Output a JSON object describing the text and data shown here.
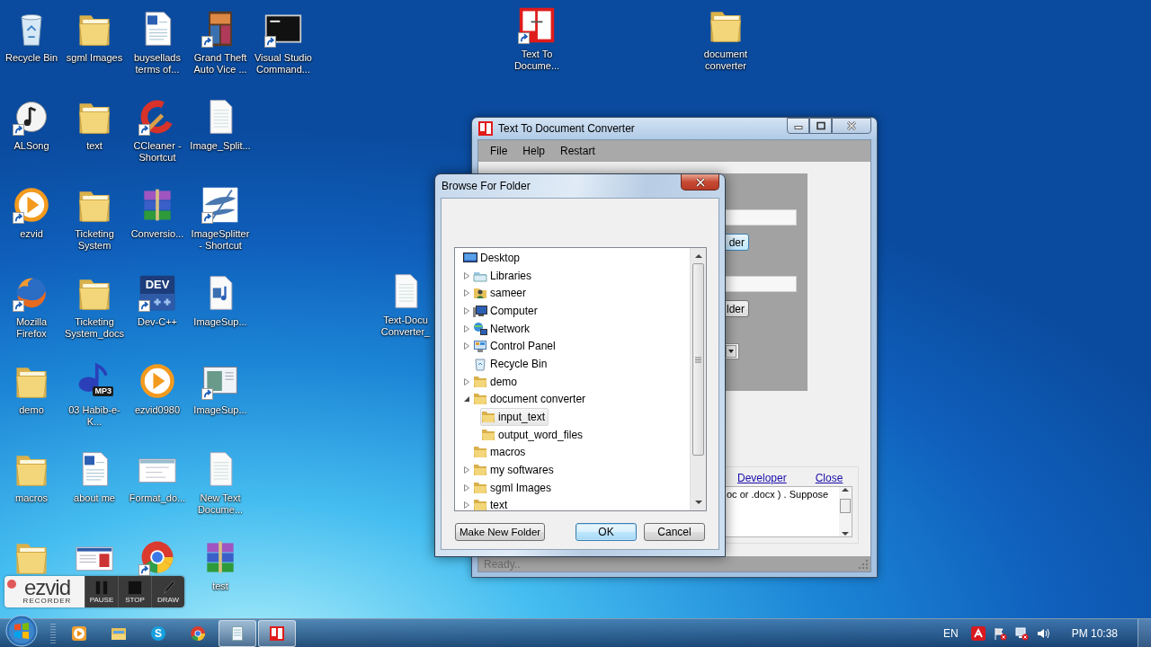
{
  "desktop": {
    "columns": [
      [
        {
          "label": "Recycle Bin",
          "kind": "recycle",
          "shortcut": false
        },
        {
          "label": "ALSong",
          "kind": "music-app",
          "shortcut": true
        },
        {
          "label": "ezvid",
          "kind": "player",
          "shortcut": true
        },
        {
          "label": "Mozilla Firefox",
          "kind": "firefox",
          "shortcut": true
        },
        {
          "label": "demo",
          "kind": "folder",
          "shortcut": false
        },
        {
          "label": "macros",
          "kind": "folder",
          "shortcut": false
        },
        {
          "kind": "folder",
          "shortcut": false
        }
      ],
      [
        {
          "label": "sgml Images",
          "kind": "folder",
          "shortcut": false
        },
        {
          "label": "text",
          "kind": "folder",
          "shortcut": false
        },
        {
          "label": "Ticketing System",
          "kind": "folder",
          "shortcut": false
        },
        {
          "label": "Ticketing System_docs",
          "kind": "folder",
          "shortcut": false
        },
        {
          "label": "03 Habib-e-K...",
          "kind": "mp3",
          "badge": "MP3",
          "shortcut": false
        },
        {
          "label": "about me",
          "kind": "word-doc",
          "shortcut": false
        },
        {
          "kind": "screenshot",
          "shortcut": false
        }
      ],
      [
        {
          "label": "buysellads terms of...",
          "kind": "word-doc",
          "shortcut": false
        },
        {
          "label": "CCleaner - Shortcut",
          "kind": "ccleaner",
          "shortcut": true
        },
        {
          "label": "Conversio...",
          "kind": "archive",
          "shortcut": false
        },
        {
          "label": "Dev-C++",
          "kind": "dev",
          "badge": "DEV",
          "shortcut": true
        },
        {
          "label": "ezvid0980",
          "kind": "player",
          "shortcut": false
        },
        {
          "label": "Format_do...",
          "kind": "page-thumb",
          "shortcut": false
        },
        {
          "kind": "chrome",
          "shortcut": true
        }
      ],
      [
        {
          "label": "Grand Theft Auto Vice ...",
          "kind": "game",
          "shortcut": true
        },
        {
          "label": "Image_Split...",
          "kind": "text-file",
          "shortcut": false
        },
        {
          "label": "ImageSplitter - Shortcut",
          "kind": "splitter",
          "shortcut": true
        },
        {
          "label": "ImageSup...",
          "kind": "media-file",
          "shortcut": false
        },
        {
          "label": "ImageSup...",
          "kind": "window-thumb",
          "shortcut": true
        },
        {
          "label": "New Text Docume...",
          "kind": "text-file",
          "shortcut": false
        },
        {
          "label": "test",
          "kind": "archive",
          "shortcut": false
        }
      ],
      [
        {
          "label": "Visual Studio Command...",
          "kind": "console",
          "shortcut": true
        }
      ]
    ],
    "loose_icons": [
      {
        "label": "Text To Docume...",
        "kind": "converter-app",
        "shortcut": true
      },
      {
        "label": "document converter",
        "kind": "folder",
        "shortcut": false
      },
      {
        "label": "Text-Docu Converter_",
        "kind": "text-file",
        "shortcut": false
      }
    ]
  },
  "converter_window": {
    "title": "Text To Document Converter",
    "menu": [
      "File",
      "Help",
      "Restart"
    ],
    "panel_buttons": [
      "der",
      "lder"
    ],
    "links": [
      "Developer",
      "Close"
    ],
    "notes": "oc or .docx ) . Suppose",
    "status": "Ready.."
  },
  "dialog": {
    "title": "Browse For Folder",
    "tree": [
      {
        "label": "Desktop",
        "kind": "desktop",
        "expandable": false,
        "selected": false,
        "children": [
          {
            "label": "Libraries",
            "kind": "libraries",
            "expandable": true,
            "expanded": false,
            "selected": false
          },
          {
            "label": "sameer",
            "kind": "user",
            "expandable": true,
            "expanded": false,
            "selected": false
          },
          {
            "label": "Computer",
            "kind": "computer",
            "expandable": true,
            "expanded": false,
            "selected": false
          },
          {
            "label": "Network",
            "kind": "network",
            "expandable": true,
            "expanded": false,
            "selected": false
          },
          {
            "label": "Control Panel",
            "kind": "control-panel",
            "expandable": true,
            "expanded": false,
            "selected": false
          },
          {
            "label": "Recycle Bin",
            "kind": "recycle",
            "expandable": false,
            "selected": false
          },
          {
            "label": "demo",
            "kind": "folder",
            "expandable": true,
            "expanded": false,
            "selected": false
          },
          {
            "label": "document converter",
            "kind": "folder",
            "expandable": true,
            "expanded": true,
            "selected": false,
            "children": [
              {
                "label": "input_text",
                "kind": "folder",
                "expandable": false,
                "selected": true
              },
              {
                "label": "output_word_files",
                "kind": "folder",
                "expandable": false,
                "selected": false
              }
            ]
          },
          {
            "label": "macros",
            "kind": "folder",
            "expandable": false,
            "selected": false
          },
          {
            "label": "my softwares",
            "kind": "folder",
            "expandable": true,
            "expanded": false,
            "selected": false
          },
          {
            "label": "sgml Images",
            "kind": "folder",
            "expandable": true,
            "expanded": false,
            "selected": false
          },
          {
            "label": "text",
            "kind": "folder",
            "expandable": true,
            "expanded": false,
            "selected": false
          }
        ]
      }
    ],
    "buttons": [
      {
        "label": "Make New Folder",
        "default": false
      },
      {
        "label": "OK",
        "default": true
      },
      {
        "label": "Cancel",
        "default": false
      }
    ]
  },
  "recorder": {
    "logo": "ezvid",
    "subtitle": "RECORDER",
    "buttons": [
      {
        "label": "PAUSE",
        "kind": "pause"
      },
      {
        "label": "STOP",
        "kind": "stop"
      },
      {
        "label": "DRAW",
        "kind": "draw"
      }
    ]
  },
  "taskbar": {
    "items": [
      {
        "kind": "media-player",
        "active": false
      },
      {
        "kind": "file-explorer",
        "active": false
      },
      {
        "kind": "skype",
        "glyph": "S",
        "active": false
      },
      {
        "kind": "chrome",
        "active": false
      },
      {
        "kind": "notepad",
        "active": true
      },
      {
        "kind": "converter",
        "active": true
      }
    ],
    "language": "EN",
    "clock": "PM 10:38"
  }
}
